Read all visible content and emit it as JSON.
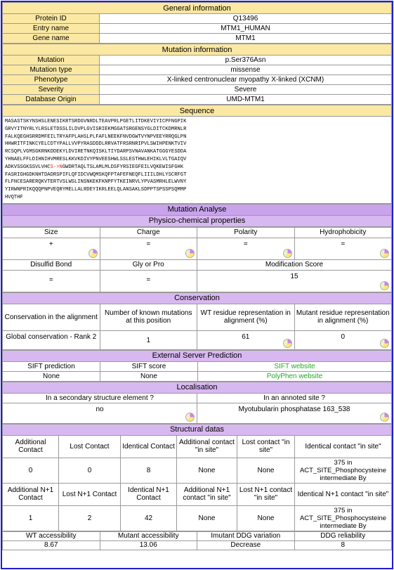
{
  "general": {
    "title": "General information",
    "rows": [
      {
        "label": "Protein ID",
        "value": "Q13496"
      },
      {
        "label": "Entry name",
        "value": "MTM1_HUMAN"
      },
      {
        "label": "Gene name",
        "value": "MTM1"
      }
    ]
  },
  "mutation": {
    "title": "Mutation information",
    "rows": [
      {
        "label": "Mutation",
        "value": "p.Ser376Asn"
      },
      {
        "label": "Mutation type",
        "value": "missense"
      },
      {
        "label": "Phenotype",
        "value": "X-linked centronuclear myopathy X-linked (XCNM)"
      },
      {
        "label": "Severity",
        "value": "Severe"
      },
      {
        "label": "Database Origin",
        "value": "UMD-MTM1"
      }
    ]
  },
  "sequence": {
    "title": "Sequence",
    "lines": [
      "MASASTSKYNSHSLENESIKRTSRDGVNRDLTEAVPRLPGETLITDKEVIYICPFNGPIK",
      "GRVYITNYRLYLRSLETDSSLILDVPLGVISRIEKMGGATSRGENSYGLDITCKDMRNLR",
      "FALKQEGHSRRDMFEILTRYAFPLAHSLPLFAFLNEEKFNVDGWTVYNPVEEYRRQGLPN",
      "HHWRITFINKCYELCDTYPALLVVPYRASDDDLRRVATFRSRNRIPVLSWIHPENKTVIV",
      "RCSQPLVGMSGKRNKDDEKYLDVIRETNKQISKLTIYDARPSVNAVANKATGGGYESDDA",
      "YHNAELFFLDIHNIHVMRESLKKVKDIVYPNVEESHWLSSLESTHWLEHIKLVLTGAIQV",
      "ADKVSSGKSSVLVHC",
      "GWDRTAQLTSLAMLMLDSFYRSIEGFEILVQKEWISFGHK",
      "FASRIGHGDKNHTDADRSPIFLQFIDCVWQMSKQFPTAFEFNEQFLIIILDHLYSCRFGT",
      "FLFNCESARERQKVTERTVSLWSLINSNKEKFKNPFYTKEINRVLYPVASMRHLELWVNY",
      "YIRWNPRIKQQQPNPVEQRYMELLALRDEYIKRLEELQLANSAKLSDPPTSPSSPSQMMP",
      "HVQTHF"
    ],
    "mutation_mark": "S->N"
  },
  "analyse": {
    "title": "Mutation Analyse",
    "physico": {
      "title": "Physico-chemical properties",
      "row1": [
        {
          "label": "Size",
          "value": "+"
        },
        {
          "label": "Charge",
          "value": "="
        },
        {
          "label": "Polarity",
          "value": "="
        },
        {
          "label": "Hydrophobicity",
          "value": "="
        }
      ],
      "row2": [
        {
          "label": "Disulfid Bond",
          "value": "="
        },
        {
          "label": "Gly or Pro",
          "value": "="
        },
        {
          "label": "Modification Score",
          "value": "15"
        }
      ]
    },
    "conservation": {
      "title": "Conservation",
      "headers": [
        "Conservation in the alignment",
        "Number of known mutations at this position",
        "WT residue representation in alignment (%)",
        "Mutant residue representation in alignment (%)"
      ],
      "values": [
        "Global conservation - Rank 2",
        "1",
        "61",
        "0"
      ]
    },
    "external": {
      "title": "External Server Prediction",
      "headers": [
        "SIFT prediction",
        "SIFT score",
        "SIFT website"
      ],
      "values": [
        "None",
        "None",
        "PolyPhen website"
      ]
    },
    "localisation": {
      "title": "Localisation",
      "headers": [
        "In a secondary structure element ?",
        "In an annoted site ?"
      ],
      "values": [
        "no",
        "Myotubularin phosphatase 163_538"
      ]
    },
    "structural": {
      "title": "Structural datas",
      "headers1": [
        "Additional Contact",
        "Lost Contact",
        "Identical Contact",
        "Additional contact \"in site\"",
        "Lost contact \"in site\"",
        "Identical contact \"in site\""
      ],
      "values1": [
        "0",
        "0",
        "8",
        "None",
        "None",
        "375 in ACT_SITE_Phosphocysteine intermediate By"
      ],
      "headers2": [
        "Additional N+1 Contact",
        "Lost N+1 Contact",
        "Identical N+1 Contact",
        "Additional N+1 contact \"in site\"",
        "Lost N+1 contact \"in site\"",
        "Identical N+1 contact \"in site\""
      ],
      "values2": [
        "1",
        "2",
        "42",
        "None",
        "None",
        "375 in ACT_SITE_Phosphocysteine intermediate By"
      ],
      "headers3": [
        "WT accessibility",
        "Mutant accessibility",
        "Imutant DDG variation",
        "DDG reliability"
      ],
      "values3": [
        "8.67",
        "13.06",
        "Decrease",
        "8"
      ]
    }
  }
}
